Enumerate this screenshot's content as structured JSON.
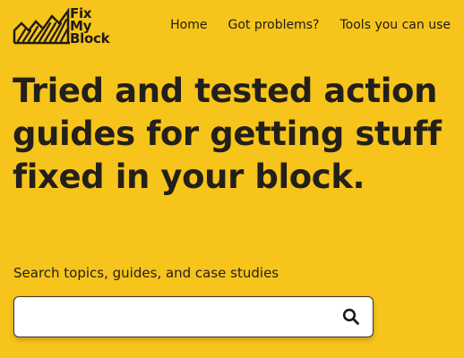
{
  "brand": {
    "logo_text": "Fix\nMy\nBlock",
    "logo_icon": "city-skyline-icon"
  },
  "nav": {
    "items": [
      {
        "label": "Home"
      },
      {
        "label": "Got problems?"
      },
      {
        "label": "Tools you can use"
      }
    ]
  },
  "hero": {
    "title": "Tried and tested action guides for getting stuff fixed in your block."
  },
  "search": {
    "label": "Search topics, guides, and case studies",
    "value": "",
    "placeholder": "",
    "button_icon": "search-icon"
  },
  "colors": {
    "background": "#F6C41B",
    "text": "#231F1B",
    "input_bg": "#FFFFFF"
  }
}
